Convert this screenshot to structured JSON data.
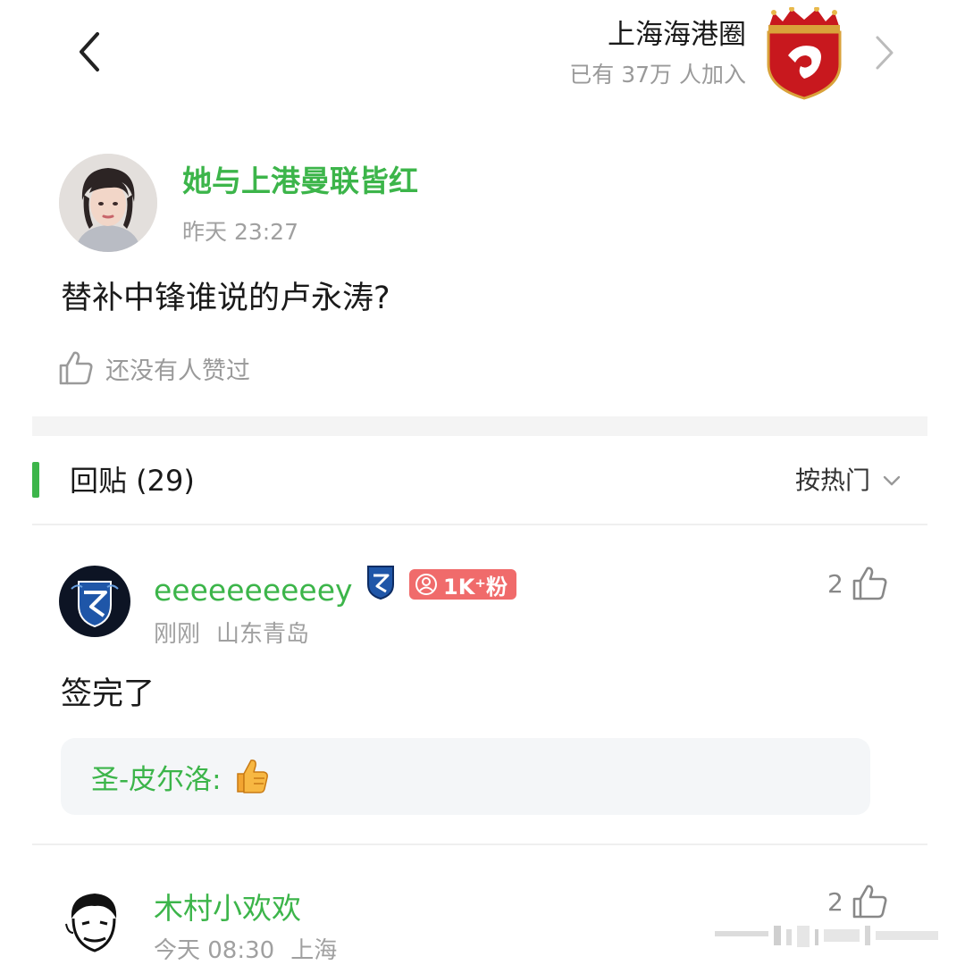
{
  "header": {
    "circle_title": "上海海港圈",
    "circle_members": "已有 37万 人加入"
  },
  "post": {
    "author": "她与上港曼联皆红",
    "time": "昨天 23:27",
    "content": "替补中锋谁说的卢永涛?",
    "like_text": "还没有人赞过"
  },
  "replies": {
    "title": "回贴 (29)",
    "sort_label": "按热门",
    "items": [
      {
        "name": "eeeeeeeeeey",
        "fan_badge": "1K⁺粉",
        "time": "刚刚",
        "location": "山东青岛",
        "likes": "2",
        "content": "签完了",
        "quote_author": "圣-皮尔洛:"
      },
      {
        "name": "木村小欢欢",
        "time": "今天 08:30",
        "location": "上海",
        "likes": "2"
      }
    ]
  },
  "colors": {
    "accent_green": "#3cb54a",
    "badge_red": "#f06b6b",
    "club_red": "#c8181e"
  },
  "icons": [
    "back-arrow-icon",
    "forward-arrow-icon",
    "thumbs-up-icon",
    "chevron-down-icon",
    "thumbs-up-emoji",
    "person-icon"
  ]
}
